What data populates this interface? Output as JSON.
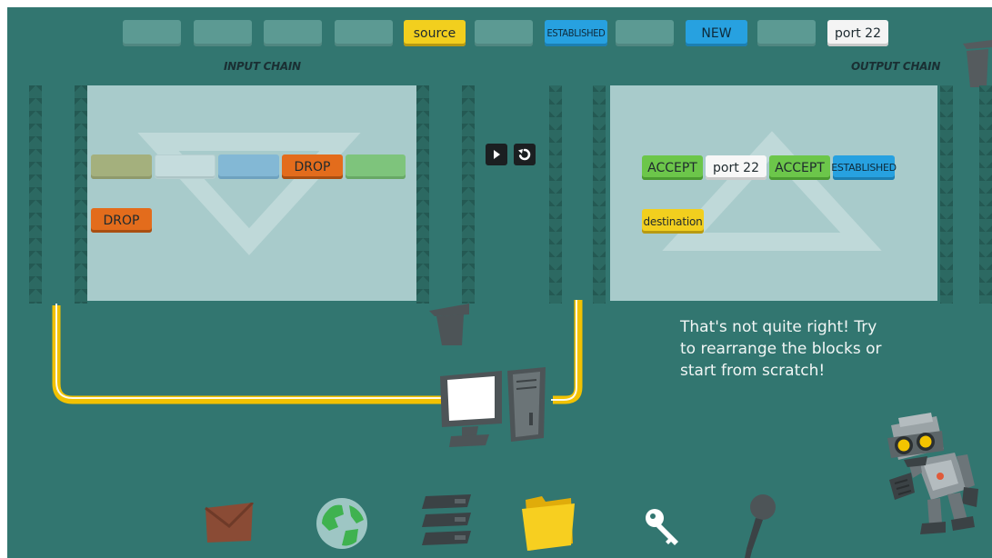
{
  "palette": {
    "blocks": [
      {
        "label": "",
        "style": "empty"
      },
      {
        "label": "",
        "style": "empty"
      },
      {
        "label": "",
        "style": "empty"
      },
      {
        "label": "",
        "style": "empty"
      },
      {
        "label": "source",
        "style": "yellow"
      },
      {
        "label": "",
        "style": "empty"
      },
      {
        "label": "ESTABLISHED",
        "style": "blue"
      },
      {
        "label": "",
        "style": "empty"
      },
      {
        "label": "NEW",
        "style": "blue"
      },
      {
        "label": "",
        "style": "empty"
      },
      {
        "label": "port 22",
        "style": "white"
      }
    ]
  },
  "input_chain": {
    "title": "INPUT CHAIN",
    "row1": [
      {
        "label": "",
        "style": "olive"
      },
      {
        "label": "",
        "style": "pale"
      },
      {
        "label": "",
        "style": "sky"
      },
      {
        "label": "DROP",
        "style": "orange"
      },
      {
        "label": "",
        "style": "green"
      }
    ],
    "row2": [
      {
        "label": "DROP",
        "style": "orange"
      }
    ]
  },
  "output_chain": {
    "title": "OUTPUT CHAIN",
    "row1": [
      {
        "label": "ACCEPT",
        "style": "accept"
      },
      {
        "label": "port 22",
        "style": "white"
      },
      {
        "label": "ACCEPT",
        "style": "accept"
      },
      {
        "label": "ESTABLISHED",
        "style": "blue"
      }
    ],
    "row2": [
      {
        "label": "destination",
        "style": "yellow"
      }
    ]
  },
  "controls": {
    "play_icon": "play-icon",
    "reset_icon": "reset-icon"
  },
  "feedback": {
    "message": "That's not quite right! Try to rearrange the blocks or start from scratch!"
  },
  "dock": {
    "icons": [
      "envelope-icon",
      "globe-icon",
      "server-rack-icon",
      "folder-icon",
      "key-icon",
      "microphone-icon"
    ]
  },
  "colors": {
    "background": "#327670",
    "panel": "#a8cbcb",
    "pipe": "#f2c200",
    "block_yellow": "#f2cf1e",
    "block_blue": "#27a1e0",
    "block_orange": "#e36c1c",
    "block_green": "#6cc64a"
  }
}
